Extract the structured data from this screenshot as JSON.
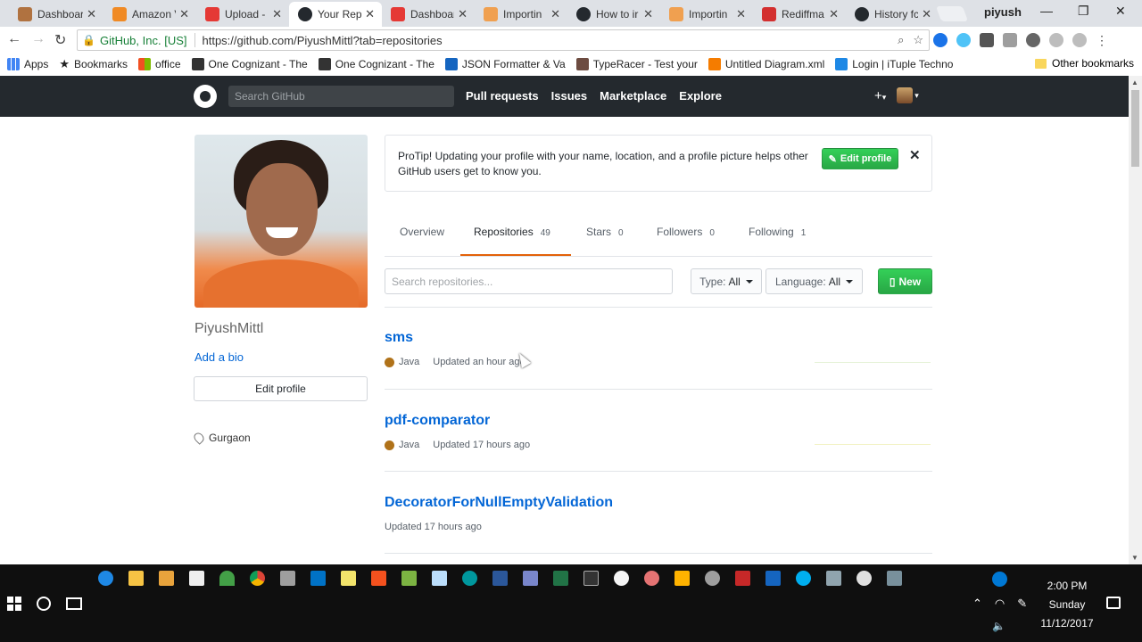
{
  "browser": {
    "tabs": [
      {
        "label": "Dashboar",
        "color": "#b07240"
      },
      {
        "label": "Amazon V",
        "color": "#f08a24"
      },
      {
        "label": "Upload -",
        "color": "#e53935"
      },
      {
        "label": "Your Rep",
        "color": "#24292e",
        "active": true
      },
      {
        "label": "Dashboar",
        "color": "#e53935"
      },
      {
        "label": "Importin",
        "color": "#f0a050"
      },
      {
        "label": "How to ir",
        "color": "#24292e"
      },
      {
        "label": "Importin",
        "color": "#f0a050"
      },
      {
        "label": "Rediffma",
        "color": "#d32f2f"
      },
      {
        "label": "History fc",
        "color": "#24292e"
      }
    ],
    "user": "piyush",
    "secure_label": "GitHub, Inc. [US]",
    "url": "https://github.com/PiyushMittl?tab=repositories",
    "bookmarks": [
      {
        "label": "Apps",
        "color": "#4285f4"
      },
      {
        "label": "Bookmarks",
        "color": "#333333"
      },
      {
        "label": "office",
        "color": "#f25022"
      },
      {
        "label": "One Cognizant - The",
        "color": "#333333"
      },
      {
        "label": "One Cognizant - The",
        "color": "#333333"
      },
      {
        "label": "JSON Formatter & Va",
        "color": "#1565c0"
      },
      {
        "label": "TypeRacer - Test your",
        "color": "#6d4c41"
      },
      {
        "label": "Untitled Diagram.xml",
        "color": "#f57c00"
      },
      {
        "label": "Login | iTuple Techno",
        "color": "#1e88e5"
      }
    ],
    "other_bookmarks": "Other bookmarks"
  },
  "github": {
    "search_placeholder": "Search GitHub",
    "nav": [
      "Pull requests",
      "Issues",
      "Marketplace",
      "Explore"
    ],
    "plus": "+",
    "profile": {
      "name": "PiyushMittl",
      "add_bio": "Add a bio",
      "edit_profile": "Edit profile",
      "location": "Gurgaon"
    },
    "protip": {
      "text": "ProTip! Updating your profile with your name, location, and a profile picture helps other GitHub users get to know you.",
      "button": "Edit profile",
      "close": "✕"
    },
    "tabs": [
      {
        "label": "Overview",
        "count": ""
      },
      {
        "label": "Repositories",
        "count": "49"
      },
      {
        "label": "Stars",
        "count": "0"
      },
      {
        "label": "Followers",
        "count": "0"
      },
      {
        "label": "Following",
        "count": "1"
      }
    ],
    "filter": {
      "search_placeholder": "Search repositories...",
      "type_label": "Type:",
      "type_value": "All",
      "language_label": "Language:",
      "language_value": "All",
      "new_label": "New"
    },
    "repos": [
      {
        "name": "sms",
        "language": "Java",
        "updated": "Updated an hour ago"
      },
      {
        "name": "pdf-comparator",
        "language": "Java",
        "updated": "Updated 17 hours ago"
      },
      {
        "name": "DecoratorForNullEmptyValidation",
        "language": "",
        "updated": "Updated 17 hours ago"
      }
    ]
  },
  "taskbar": {
    "time": "2:00 PM",
    "day": "Sunday",
    "date": "11/12/2017"
  },
  "colors": {
    "github_header": "#24292e",
    "link": "#0366d6",
    "green": "#28a745",
    "java": "#b07219",
    "tab_underline": "#e36209"
  }
}
